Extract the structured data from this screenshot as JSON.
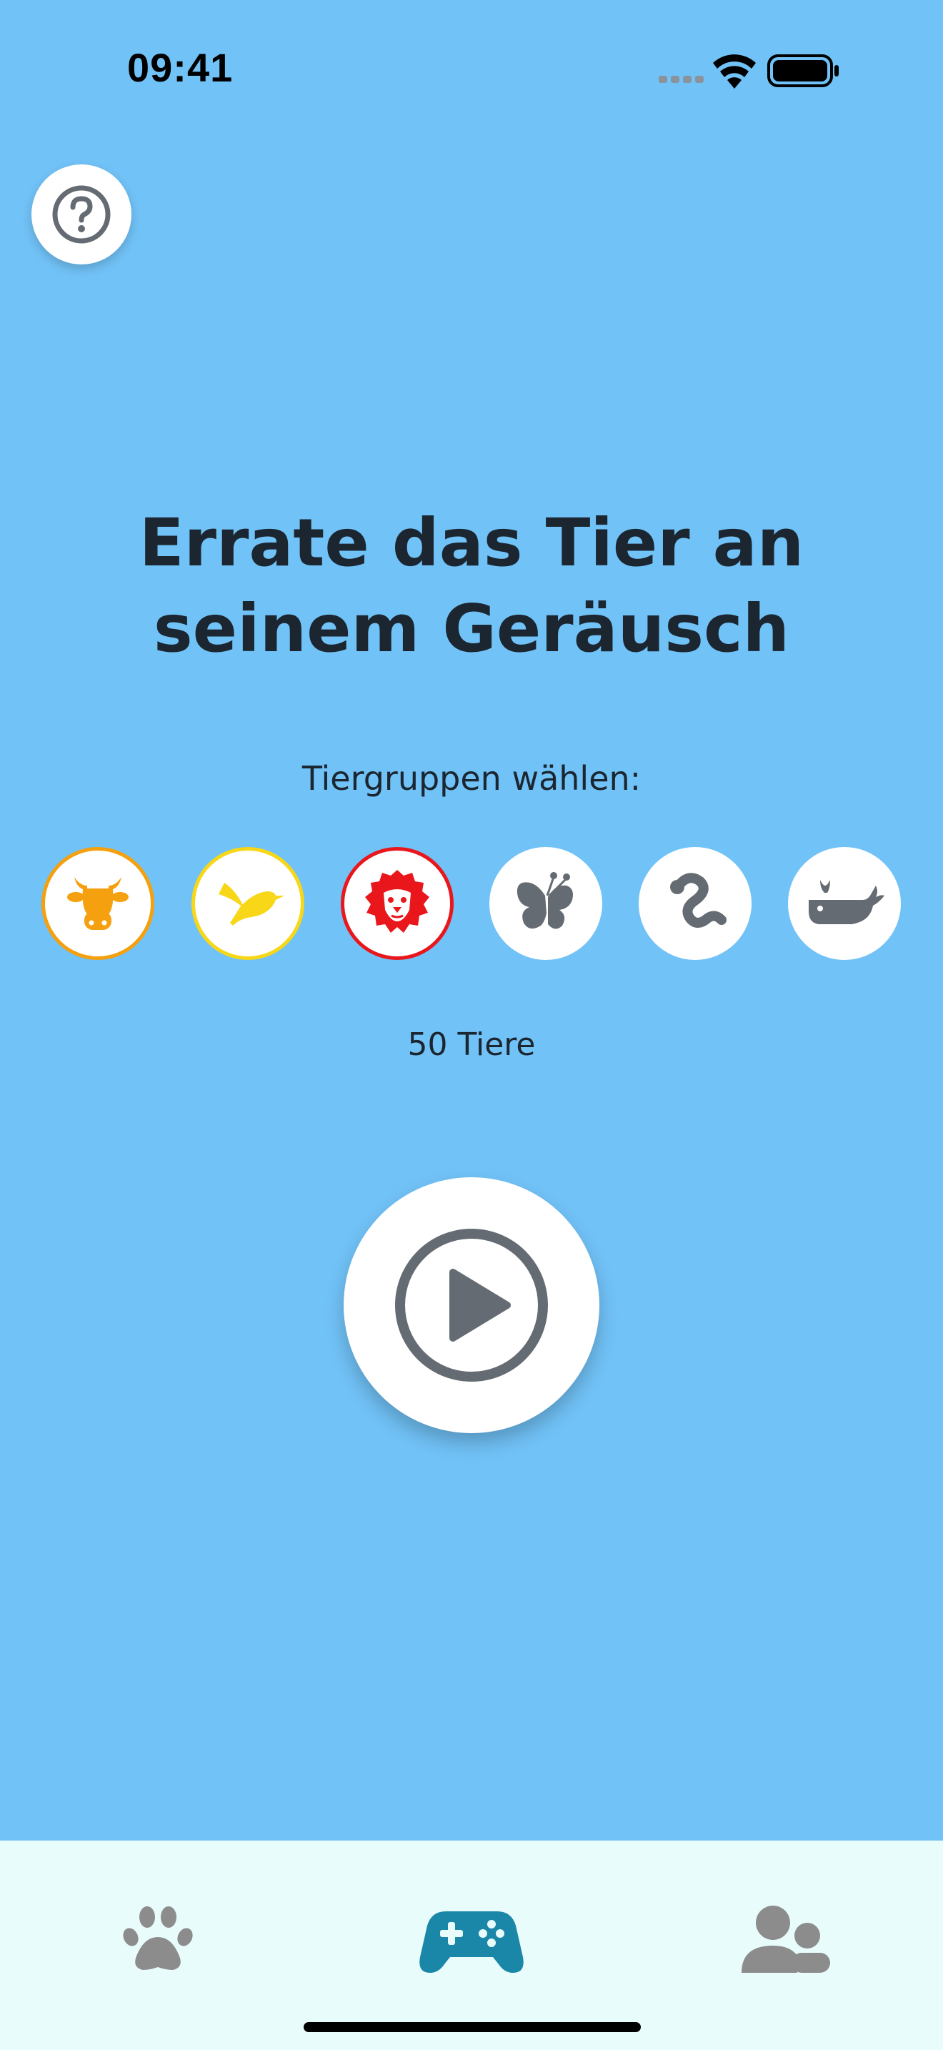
{
  "status_bar": {
    "time": "09:41",
    "icons": [
      "signal-icon",
      "wifi-icon",
      "battery-icon"
    ]
  },
  "help": {
    "icon": "question-circle-icon"
  },
  "headline": {
    "line1": "Errate das Tier an",
    "line2": "seinem Geräusch"
  },
  "group_selector": {
    "label": "Tiergruppen wählen:",
    "groups": [
      {
        "icon": "cow-icon",
        "selected": true,
        "color": "#f5a00e"
      },
      {
        "icon": "bird-icon",
        "selected": true,
        "color": "#f7d718"
      },
      {
        "icon": "lion-icon",
        "selected": true,
        "color": "#e9161c"
      },
      {
        "icon": "butterfly-icon",
        "selected": false,
        "color": "#646b72"
      },
      {
        "icon": "snake-icon",
        "selected": false,
        "color": "#646b72"
      },
      {
        "icon": "whale-icon",
        "selected": false,
        "color": "#646b72"
      }
    ]
  },
  "animal_count": "50 Tiere",
  "play": {
    "icon": "play-circle-icon"
  },
  "tab_bar": {
    "tabs": [
      {
        "icon": "paw-icon",
        "active": false
      },
      {
        "icon": "gamepad-icon",
        "active": true
      },
      {
        "icon": "users-icon",
        "active": false
      }
    ]
  },
  "colors": {
    "background": "#71c2f7",
    "tab_bar": "#e9fcfc",
    "active_tab": "#1a86a8",
    "inactive_tab": "#8c8c8c",
    "icon_gray": "#646b72"
  }
}
